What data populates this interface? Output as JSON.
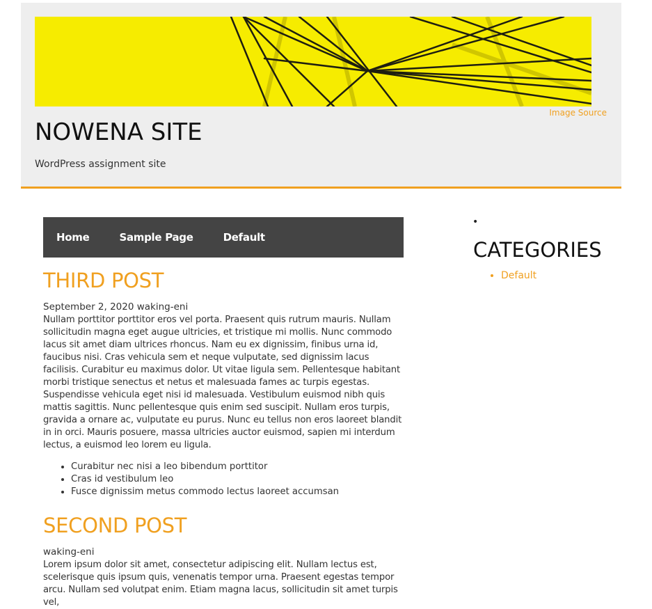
{
  "header": {
    "image_source_label": "Image Source",
    "site_title": "NOWENA SITE",
    "site_description": "WordPress assignment site"
  },
  "nav": {
    "items": [
      {
        "label": "Home"
      },
      {
        "label": "Sample Page"
      },
      {
        "label": "Default"
      }
    ]
  },
  "posts": [
    {
      "title": "THIRD POST",
      "meta": "September 2, 2020 waking-eni",
      "body": "Nullam porttitor porttitor eros vel porta. Praesent quis rutrum mauris. Nullam sollicitudin magna eget augue ultricies, et tristique mi mollis. Nunc commodo lacus sit amet diam ultrices rhoncus. Nam eu ex dignissim, finibus urna id, faucibus nisi. Cras vehicula sem et neque vulputate, sed dignissim lacus facilisis. Curabitur eu maximus dolor. Ut vitae ligula sem. Pellentesque habitant morbi tristique senectus et netus et malesuada fames ac turpis egestas. Suspendisse vehicula eget nisi id malesuada. Vestibulum euismod nibh quis mattis sagittis. Nunc pellentesque quis enim sed suscipit. Nullam eros turpis, gravida a ornare ac, vulputate eu purus. Nunc eu tellus non eros laoreet blandit in in orci. Mauris posuere, massa ultricies auctor euismod, sapien mi interdum lectus, a euismod leo lorem eu ligula.",
      "list": [
        "Curabitur nec nisi a leo bibendum porttitor",
        "Cras id vestibulum leo",
        "Fusce dignissim metus commodo lectus laoreet accumsan"
      ]
    },
    {
      "title": "SECOND POST",
      "meta": "waking-eni",
      "body": "Lorem ipsum dolor sit amet, consectetur adipiscing elit. Nullam lectus est, scelerisque quis ipsum quis, venenatis tempor urna. Praesent egestas tempor arcu. Nullam sed volutpat enim. Etiam magna lacus, sollicitudin sit amet turpis vel,"
    }
  ],
  "sidebar": {
    "bullet": "•",
    "heading": "CATEGORIES",
    "categories": [
      {
        "label": "Default"
      }
    ]
  },
  "colors": {
    "accent": "#f0a020",
    "header_bg": "#eeeeee",
    "nav_bg": "#444444",
    "banner_yellow": "#f6ec00"
  },
  "icons": {
    "banner": "geometric-wire-sculpture-image"
  }
}
